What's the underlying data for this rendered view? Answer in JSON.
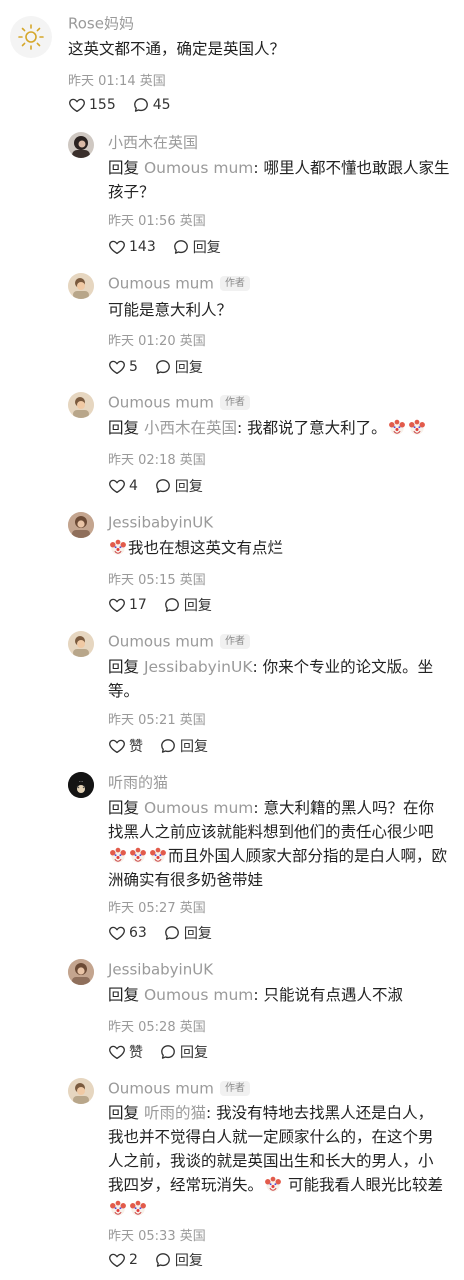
{
  "comments": [
    {
      "user": "Rose妈妈",
      "text": "这英文都不通，确定是英国人？",
      "time": "昨天 01:14",
      "location": "英国",
      "likes": "155",
      "replies": "45"
    },
    {
      "user": "小西木在英国",
      "reply_prefix": "回复 ",
      "reply_to": "Oumous mum",
      "text": ": 哪里人都不懂也敢跟人家生孩子？",
      "time": "昨天 01:56",
      "location": "英国",
      "likes": "143",
      "reply_label": "回复"
    },
    {
      "user": "Oumous mum",
      "badge": "作者",
      "text": "可能是意大利人？",
      "time": "昨天 01:20",
      "location": "英国",
      "likes": "5",
      "reply_label": "回复"
    },
    {
      "user": "Oumous mum",
      "badge": "作者",
      "reply_prefix": "回复 ",
      "reply_to": "小西木在英国",
      "text": ": 我都说了意大利了。",
      "time": "昨天 02:18",
      "location": "英国",
      "likes": "4",
      "reply_label": "回复"
    },
    {
      "user": "JessibabyinUK",
      "text": "我也在想这英文有点烂",
      "time": "昨天 05:15",
      "location": "英国",
      "likes": "17",
      "reply_label": "回复"
    },
    {
      "user": "Oumous mum",
      "badge": "作者",
      "reply_prefix": "回复 ",
      "reply_to": "JessibabyinUK",
      "text": ": 你来个专业的论文版。坐等。",
      "time": "昨天 05:21",
      "location": "英国",
      "likes": "赞",
      "reply_label": "回复"
    },
    {
      "user": "听雨的猫",
      "reply_prefix": "回复 ",
      "reply_to": "Oumous mum",
      "text_1": ": 意大利籍的黑人吗？在你找黑人之前应该就能料想到他们的责任心很少吧",
      "text_2": "而且外国人顾家大部分指的是白人啊，欧洲确实有很多奶爸带娃",
      "time": "昨天 05:27",
      "location": "英国",
      "likes": "63",
      "reply_label": "回复"
    },
    {
      "user": "JessibabyinUK",
      "reply_prefix": "回复 ",
      "reply_to": "Oumous mum",
      "text": ": 只能说有点遇人不淑",
      "time": "昨天 05:28",
      "location": "英国",
      "likes": "赞",
      "reply_label": "回复"
    },
    {
      "user": "Oumous mum",
      "badge": "作者",
      "reply_prefix": "回复 ",
      "reply_to": "听雨的猫",
      "text_1": ": 我没有特地去找黑人还是白人，我也并不觉得白人就一定顾家什么的，在这个男人之前，我谈的就是英国出生和长大的男人，小我四岁，经常玩消失。",
      "text_2": " 可能我看人眼光比较差",
      "time": "昨天 05:33",
      "location": "英国",
      "likes": "2",
      "reply_label": "回复"
    }
  ],
  "icons": {
    "heart": "heart-icon",
    "bubble": "comment-bubble-icon",
    "clown": "clown-emoji"
  },
  "colors": {
    "secondary_text": "#9a9a9a",
    "primary_text": "#222222",
    "badge_bg": "#f1f1f1"
  }
}
